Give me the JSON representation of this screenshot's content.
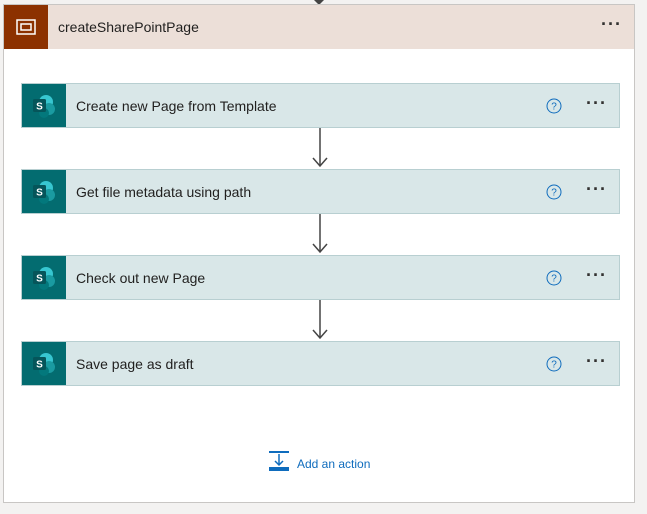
{
  "scope": {
    "title": "createSharePointPage",
    "icon": "scope-icon",
    "more_label": "···"
  },
  "actions": [
    {
      "title": "Create new Page from Template",
      "icon": "sharepoint-icon"
    },
    {
      "title": "Get file metadata using path",
      "icon": "sharepoint-icon"
    },
    {
      "title": "Check out new Page",
      "icon": "sharepoint-icon"
    },
    {
      "title": "Save page as draft",
      "icon": "sharepoint-icon"
    }
  ],
  "action_more_label": "···",
  "add_action": {
    "label": "Add an action",
    "icon": "add-action-icon"
  },
  "colors": {
    "scope_header_bg": "#ecdfd8",
    "scope_icon_bg": "#8c3100",
    "action_bg": "#d9e7e8",
    "sharepoint_icon_bg": "#036c70",
    "link": "#0f6cbd"
  }
}
